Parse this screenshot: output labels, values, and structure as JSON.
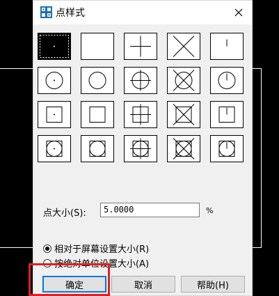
{
  "dialog": {
    "title": "点样式",
    "icon": "app-icon",
    "close_glyph": "✕"
  },
  "point_styles": {
    "rows": [
      [
        "dot",
        "none",
        "plus",
        "x",
        "tick"
      ],
      [
        "circle-dot",
        "circle",
        "circle-plus",
        "circle-x",
        "circle-tick"
      ],
      [
        "square-dot",
        "square",
        "square-plus",
        "square-x",
        "square-tick"
      ],
      [
        "circle-square-dot",
        "circle-square",
        "circle-square-plus",
        "circle-square-x",
        "circle-square-tick"
      ]
    ],
    "selected_row": 0,
    "selected_col": 0
  },
  "point_size": {
    "label": "点大小(S):",
    "value": "5.0000",
    "unit": "%"
  },
  "size_mode": {
    "options": [
      {
        "label": "相对于屏幕设置大小(R)",
        "checked": true
      },
      {
        "label": "按绝对单位设置大小(A)",
        "checked": false
      }
    ]
  },
  "buttons": {
    "ok": "确定",
    "cancel": "取消",
    "help": "帮助(H)"
  },
  "colors": {
    "highlight": "#e02020",
    "focus": "#0078d7"
  }
}
